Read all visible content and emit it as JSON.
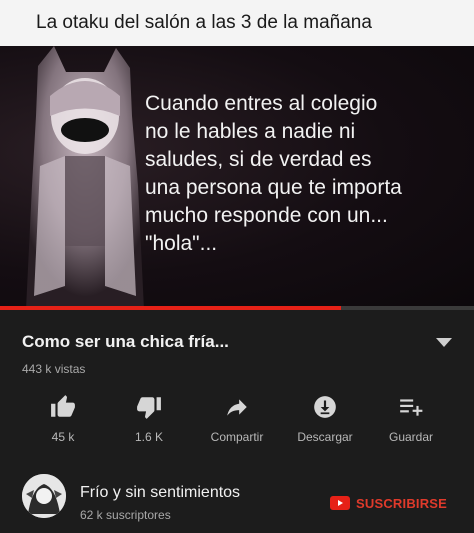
{
  "meme_caption": "La otaku del salón a las 3 de la mañana",
  "video": {
    "overlay_text": "Cuando entres al colegio\nno le hables a nadie ni\nsaludes, si de verdad es\nuna persona que te importa\n mucho responde con un...\n\"hola\"...",
    "progress": 0.72
  },
  "player": {
    "title": "Como ser una chica fría...",
    "views": "443 k vistas",
    "actions": [
      {
        "icon": "thumbs-up-icon",
        "label": "45 k"
      },
      {
        "icon": "thumbs-down-icon",
        "label": "1.6 K"
      },
      {
        "icon": "share-icon",
        "label": "Compartir"
      },
      {
        "icon": "download-icon",
        "label": "Descargar"
      },
      {
        "icon": "playlist-add-icon",
        "label": "Guardar"
      }
    ],
    "channel": {
      "name": "Frío y sin sentimientos",
      "subscribers": "62 k suscriptores",
      "subscribe_label": "SUSCRIBIRSE"
    }
  },
  "colors": {
    "accent": "#e62117",
    "panel": "#1c1c1c"
  }
}
